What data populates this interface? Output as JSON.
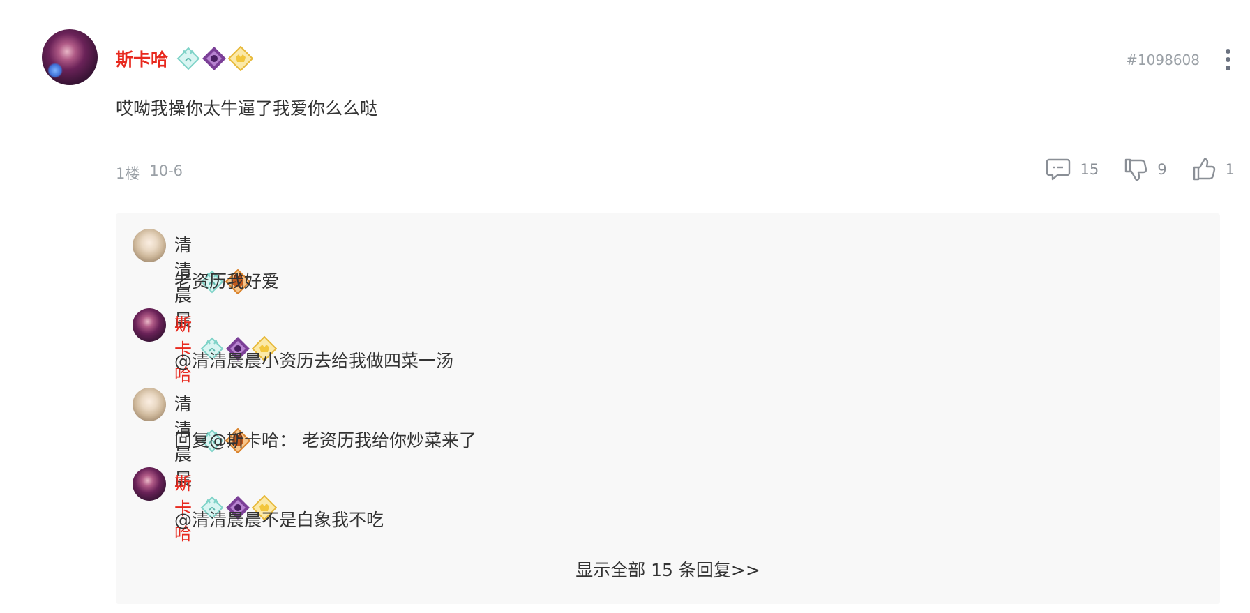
{
  "post": {
    "author": "斯卡哈",
    "id": "#1098608",
    "content": "哎呦我操你太牛逼了我爱你么么哒",
    "floor": "1楼",
    "date": "10-6",
    "actions": {
      "reply_count": "15",
      "dislike_count": "9",
      "like_count": "1"
    }
  },
  "replies": [
    {
      "author": "清清晨晨",
      "text": "老资历我好爱"
    },
    {
      "author": "斯卡哈",
      "text": "@清清晨晨小资历去给我做四菜一汤"
    },
    {
      "author": "清清晨晨",
      "text": "回复@斯卡哈： 老资历我给你炒菜来了"
    },
    {
      "author": "斯卡哈",
      "text": "@清清晨晨不是白象我不吃"
    }
  ],
  "show_all_label": "显示全部 15 条回复>>",
  "colors": {
    "author_red": "#e8291e",
    "muted": "#9aa0a6",
    "reply_bg": "#f8f8f8"
  },
  "icons": [
    "more-vertical-icon",
    "comment-icon",
    "thumbs-down-icon",
    "thumbs-up-icon",
    "cat-badge-icon",
    "purple-diamond-badge-icon",
    "gold-badge-icon",
    "orange-badge-icon"
  ]
}
